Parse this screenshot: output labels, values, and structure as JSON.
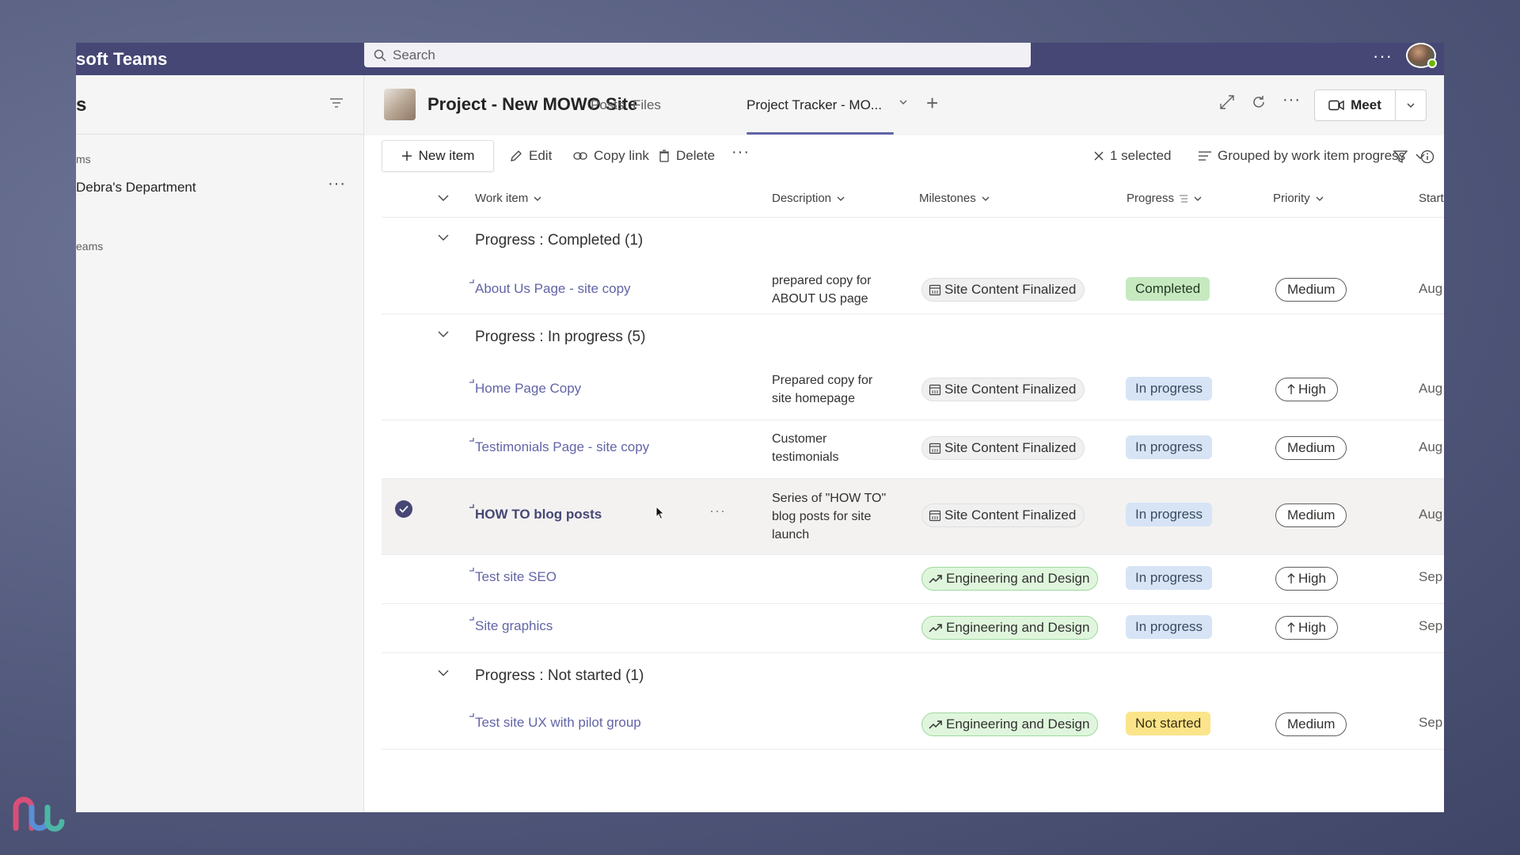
{
  "app": {
    "title": "soft Teams",
    "search_placeholder": "Search",
    "more": "···"
  },
  "left_pane": {
    "header": "s",
    "section1": "ms",
    "team_name": "Debra's Department",
    "team_more": "···",
    "section2": "eams"
  },
  "channel": {
    "title": "Project - New MOWO Site",
    "tabs": [
      {
        "label": "Posts"
      },
      {
        "label": "Files"
      },
      {
        "label": "Project Tracker - MO..."
      }
    ],
    "more": "···",
    "meet_label": "Meet"
  },
  "command_bar": {
    "new_item": "New item",
    "edit": "Edit",
    "copy_link": "Copy link",
    "delete": "Delete",
    "more": "···",
    "selected": "1 selected",
    "grouped_by": "Grouped by work item progress"
  },
  "columns": {
    "work_item": "Work item",
    "description": "Description",
    "milestones": "Milestones",
    "progress": "Progress",
    "priority": "Priority",
    "start": "Start"
  },
  "groups": [
    {
      "label": "Progress : Completed (1)"
    },
    {
      "label": "Progress : In progress (5)"
    },
    {
      "label": "Progress : Not started (1)"
    }
  ],
  "rows": [
    {
      "work_item": "About Us Page - site copy",
      "description_1": "prepared copy for",
      "description_2": "ABOUT US page",
      "milestone": "Site Content Finalized",
      "progress": "Completed",
      "priority": "Medium",
      "start": "Aug"
    },
    {
      "work_item": "Home Page Copy",
      "description_1": "Prepared copy for",
      "description_2": "site homepage",
      "milestone": "Site Content Finalized",
      "progress": "In progress",
      "priority": "High",
      "start": "Aug"
    },
    {
      "work_item": "Testimonials Page - site copy",
      "description_1": "Customer",
      "description_2": "testimonials",
      "milestone": "Site Content Finalized",
      "progress": "In progress",
      "priority": "Medium",
      "start": "Aug"
    },
    {
      "work_item": "HOW TO blog posts",
      "description_1": "Series of \"HOW TO\"",
      "description_2": "blog posts for site",
      "description_3": "launch",
      "milestone": "Site Content Finalized",
      "progress": "In progress",
      "priority": "Medium",
      "start": "Aug",
      "more": "···"
    },
    {
      "work_item": "Test site SEO",
      "milestone": "Engineering and Design",
      "progress": "In progress",
      "priority": "High",
      "start": "Sep"
    },
    {
      "work_item": "Site graphics",
      "milestone": "Engineering and Design",
      "progress": "In progress",
      "priority": "High",
      "start": "Sep"
    },
    {
      "work_item": "Test site UX with pilot group",
      "milestone": "Engineering and Design",
      "progress": "Not started",
      "priority": "Medium",
      "start": "Sep"
    }
  ],
  "colors": {
    "titlebar": "#464775",
    "accent": "#6264a7",
    "completed": "#c6e9c0",
    "in_progress": "#d6e4f5",
    "not_started": "#fbe48a",
    "milestone_green": "#dff6dd"
  }
}
